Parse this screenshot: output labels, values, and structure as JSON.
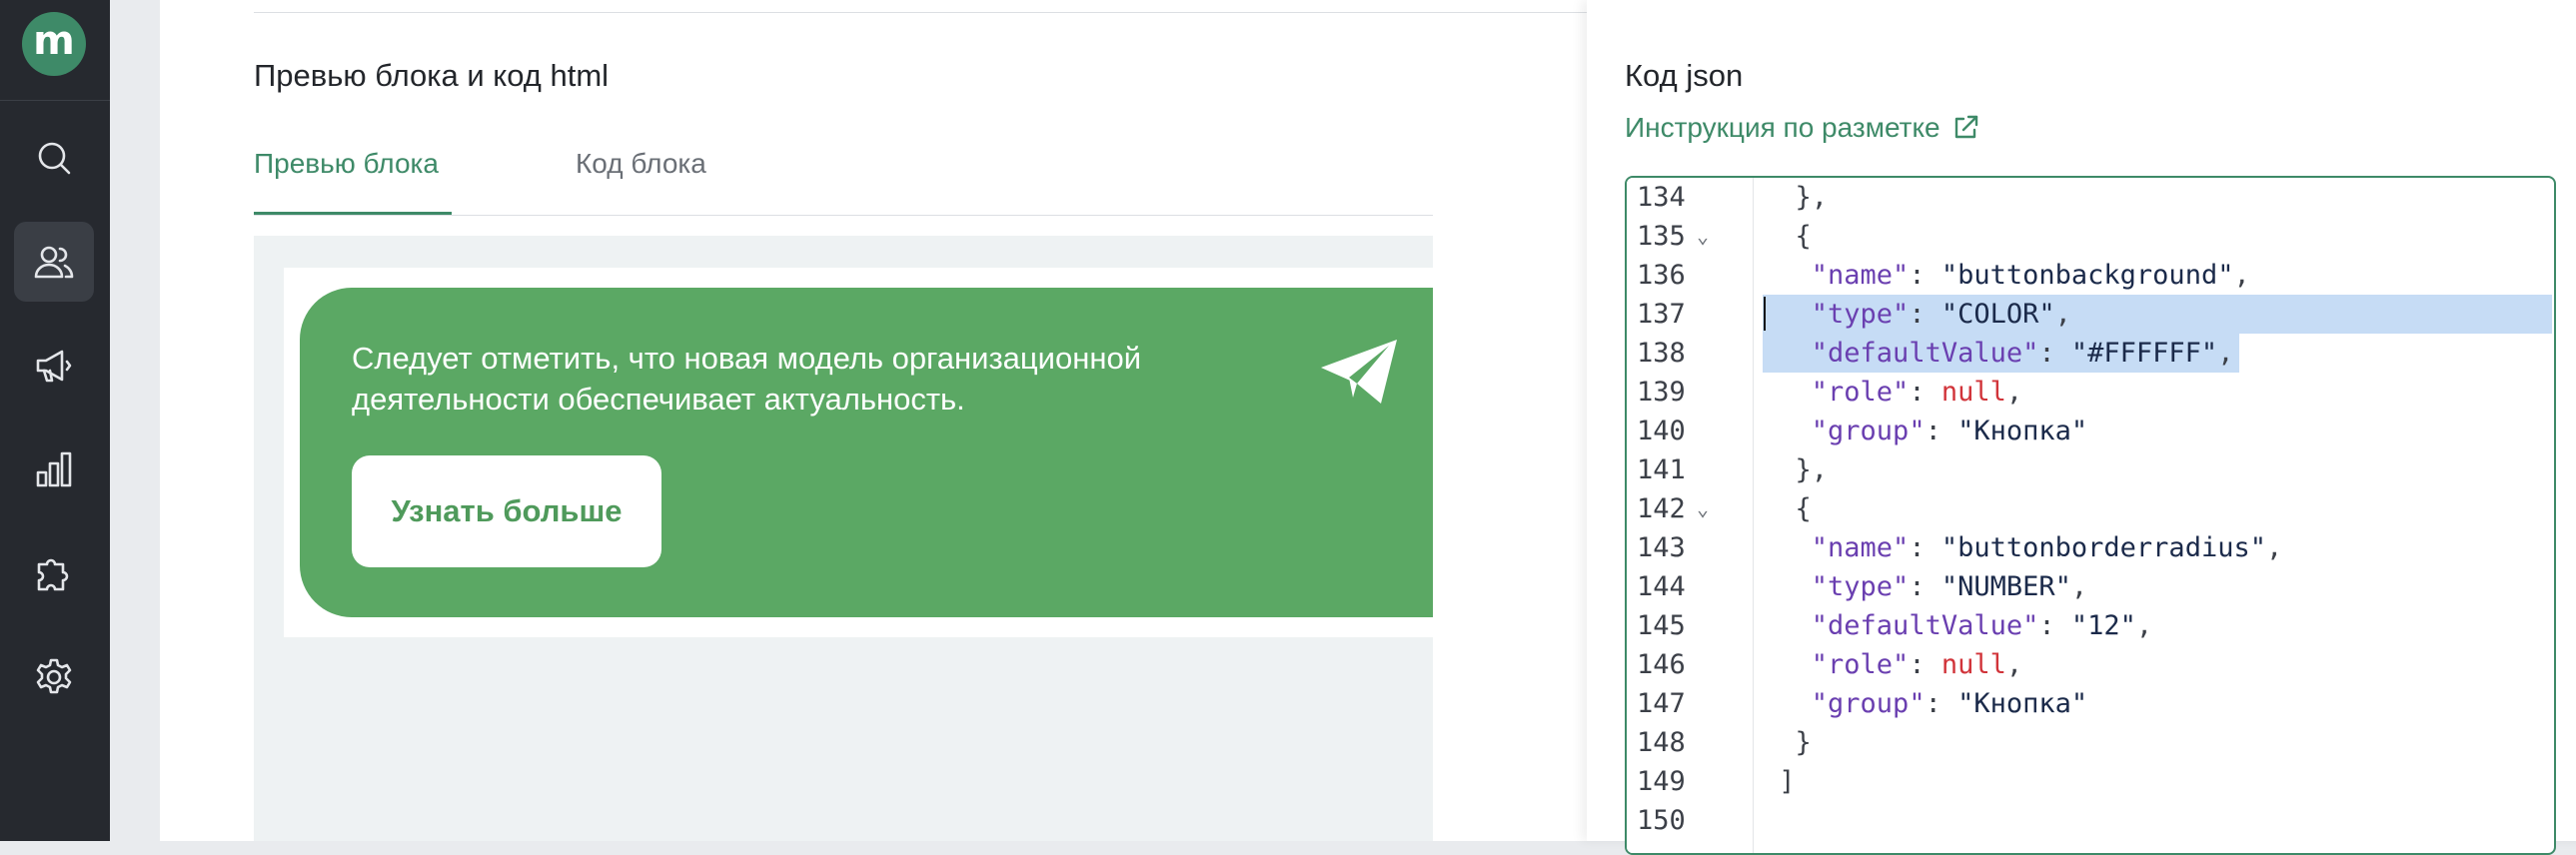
{
  "app": {
    "logo_letter": "m"
  },
  "sidebar": {
    "items": [
      {
        "icon": "search-icon"
      },
      {
        "icon": "users-icon",
        "active": true
      },
      {
        "icon": "megaphone-icon"
      },
      {
        "icon": "bar-chart-icon"
      },
      {
        "icon": "puzzle-icon"
      },
      {
        "icon": "gear-icon"
      }
    ]
  },
  "preview_section": {
    "title": "Превью блока и код html",
    "tabs": [
      {
        "label": "Превью блока",
        "active": true
      },
      {
        "label": "Код блока",
        "active": false
      }
    ],
    "banner": {
      "text": "Следует отметить, что новая модель организационной деятельности обеспечивает актуальность.",
      "button_label": "Узнать больше",
      "icon": "paper-plane-icon"
    }
  },
  "json_section": {
    "title": "Код json",
    "link_label": "Инструкция по разметке",
    "link_icon": "external-link-icon",
    "editor": {
      "lines": [
        {
          "num": "134",
          "text": "  },"
        },
        {
          "num": "135",
          "text": "  {",
          "fold": true
        },
        {
          "num": "136",
          "text": "   \"name\": \"buttonbackground\","
        },
        {
          "num": "137",
          "text": "   \"type\": \"COLOR\",",
          "selected": true
        },
        {
          "num": "138",
          "text": "   \"defaultValue\": \"#FFFFFF\",",
          "selected": true
        },
        {
          "num": "139",
          "text": "   \"role\": null,"
        },
        {
          "num": "140",
          "text": "   \"group\": \"Кнопка\""
        },
        {
          "num": "141",
          "text": "  },"
        },
        {
          "num": "142",
          "text": "  {",
          "fold": true
        },
        {
          "num": "143",
          "text": "   \"name\": \"buttonborderradius\","
        },
        {
          "num": "144",
          "text": "   \"type\": \"NUMBER\","
        },
        {
          "num": "145",
          "text": "   \"defaultValue\": \"12\","
        },
        {
          "num": "146",
          "text": "   \"role\": null,"
        },
        {
          "num": "147",
          "text": "   \"group\": \"Кнопка\""
        },
        {
          "num": "148",
          "text": "  }"
        },
        {
          "num": "149",
          "text": " ]"
        },
        {
          "num": "150",
          "text": ""
        }
      ]
    }
  },
  "colors": {
    "accent": "#3e8a68",
    "banner": "#5ba864",
    "sidebar": "#26292f",
    "selection": "#c6dcf5"
  }
}
